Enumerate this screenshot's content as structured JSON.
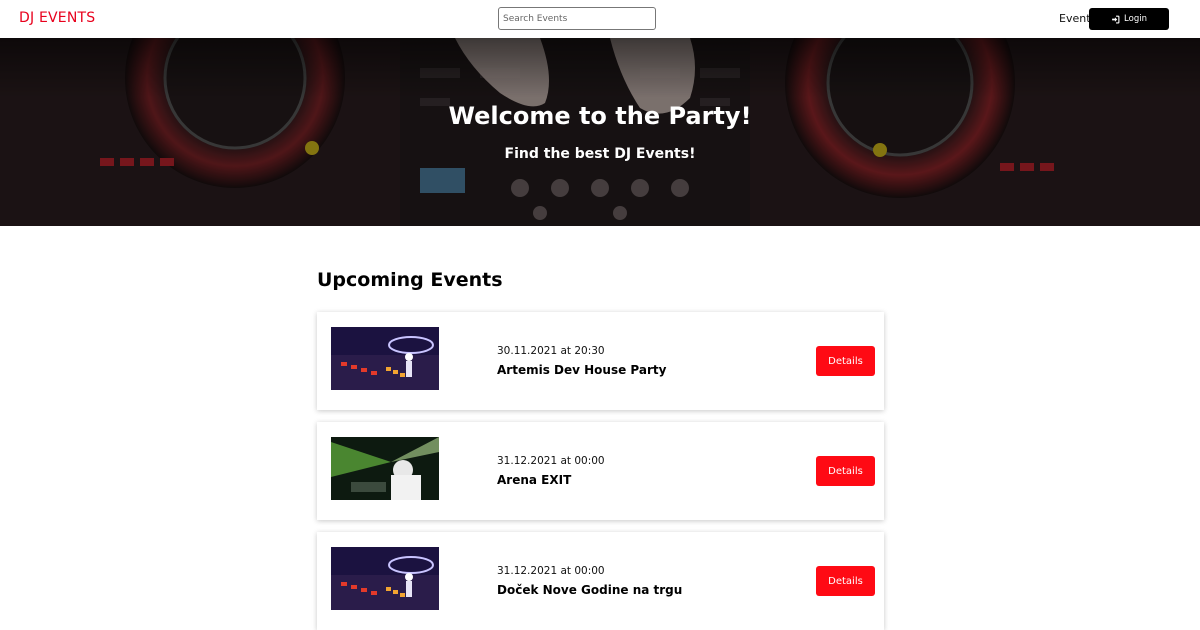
{
  "header": {
    "logo": "DJ EVENTS",
    "search_placeholder": "Search Events",
    "nav_events": "Events",
    "login_label": "Login"
  },
  "hero": {
    "title": "Welcome to the Party!",
    "subtitle": "Find the best DJ Events!"
  },
  "main": {
    "section_title": "Upcoming Events",
    "events": [
      {
        "date": "30.11.2021 at 20:30",
        "name": "Artemis Dev House Party",
        "button": "Details"
      },
      {
        "date": "31.12.2021 at 00:00",
        "name": "Arena EXIT",
        "button": "Details"
      },
      {
        "date": "31.12.2021 at 00:00",
        "name": "Doček Nove Godine na trgu",
        "button": "Details"
      }
    ]
  },
  "colors": {
    "brand": "#e8001c",
    "button": "#ff0a14",
    "login_bg": "#000000"
  }
}
